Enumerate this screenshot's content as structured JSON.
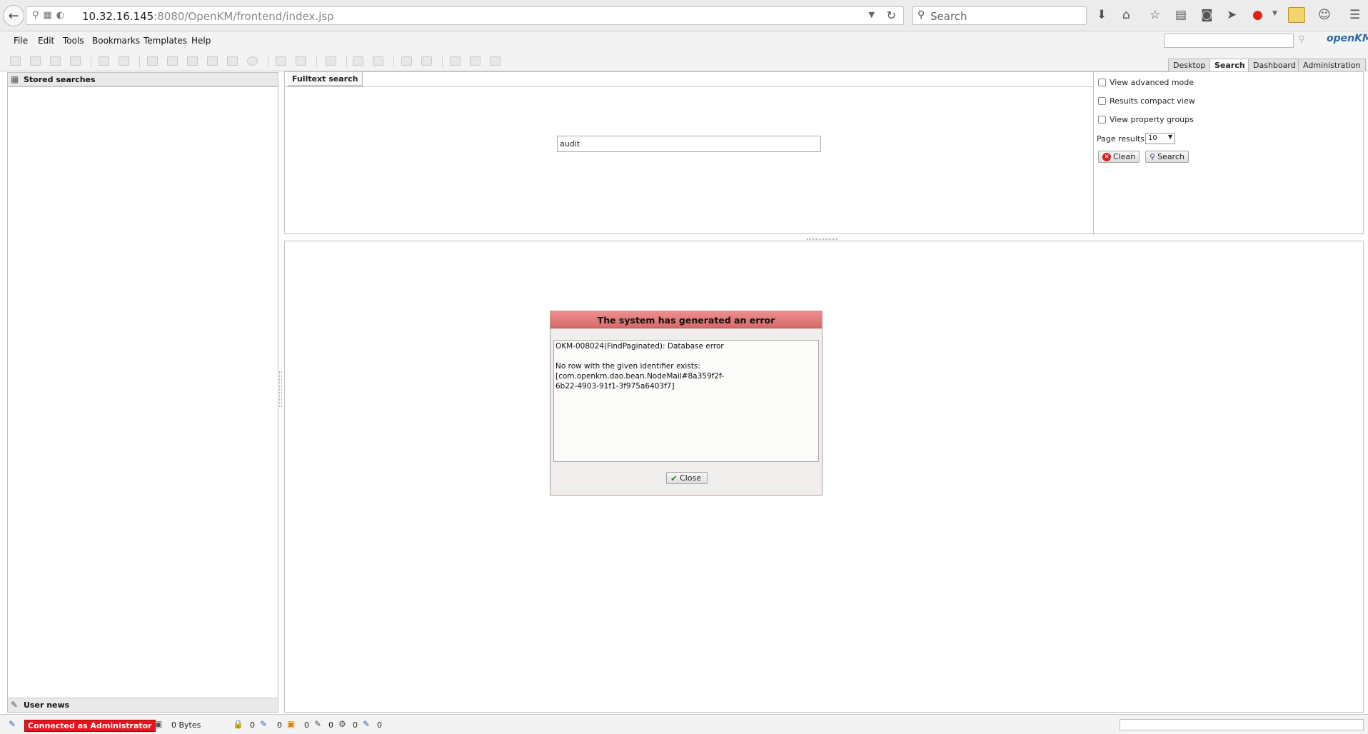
{
  "browser": {
    "url_host": "10.32.16.145",
    "url_rest": ":8080/OpenKM/frontend/index.jsp",
    "search_placeholder": "Search"
  },
  "app": {
    "menu": [
      "File",
      "Edit",
      "Tools",
      "Bookmarks",
      "Templates",
      "Help"
    ],
    "logo": "openKM",
    "nav_tabs": [
      "Desktop",
      "Search",
      "Dashboard",
      "Administration"
    ],
    "active_tab": "Search"
  },
  "left_panel": {
    "stored_searches": "Stored searches",
    "user_news": "User news"
  },
  "search": {
    "tab_label": "Fulltext search",
    "query_value": "audit",
    "options": {
      "advanced_mode": "View advanced mode",
      "compact_view": "Results compact view",
      "property_groups": "View property groups",
      "page_results_label": "Page results",
      "page_results_value": "10",
      "clean_label": "Clean",
      "search_label": "Search"
    }
  },
  "dialog": {
    "title": "The system has generated an error",
    "message": "OKM-008024(FindPaginated): Database error\n\nNo row with the given identifier exists:\n[com.openkm.dao.bean.NodeMail#8a359f2f-\n6b22-4903-91f1-3f975a6403f7]",
    "close_label": "Close"
  },
  "status": {
    "connected": "Connected as Administrator",
    "bytes": "0 Bytes",
    "locked": "0",
    "checkout": "0",
    "subscribed": "0",
    "news": "0",
    "workflows": "0",
    "proposed": "0"
  }
}
